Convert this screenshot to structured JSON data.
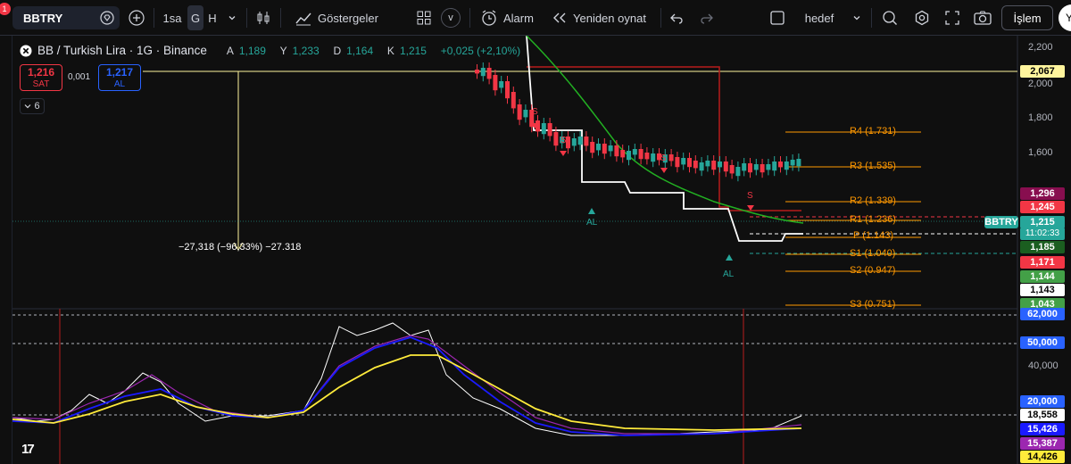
{
  "toolbar": {
    "symbol": "BBTRY",
    "notification_count": "1",
    "intervals": [
      "1sa",
      "G",
      "H"
    ],
    "indicators_label": "Göstergeler",
    "alert_label": "Alarm",
    "replay_label": "Yeniden oynat",
    "v_label": "v",
    "layout_name": "hedef",
    "trade_label": "İşlem",
    "avatar_letter": "Y"
  },
  "legend": {
    "title": "BB / Turkish Lira · 1G · Binance",
    "ohlc": [
      {
        "k": "A",
        "v": "1,189"
      },
      {
        "k": "Y",
        "v": "1,233"
      },
      {
        "k": "D",
        "v": "1,164"
      },
      {
        "k": "K",
        "v": "1,215"
      },
      {
        "k": "",
        "v": "+0,025 (+2,10%)"
      }
    ],
    "sell_price": "1,216",
    "sell_label": "SAT",
    "spread": "0,001",
    "buy_price": "1,217",
    "buy_label": "AL",
    "collapsed_count": "6"
  },
  "measure_text": "−27,318 (−96,33%) −27.318",
  "pivots": [
    "R4 (1.731)",
    "R3 (1.535)",
    "R2 (1.339)",
    "R1 (1.236)",
    "P (1.143)",
    "S1 (1.040)",
    "S2 (0.947)",
    "S3 (0.751)"
  ],
  "signals": {
    "sell": "S",
    "buy": "AL"
  },
  "price_axis": [
    "2,200",
    "2,000",
    "1,800",
    "1,600",
    "40,000"
  ],
  "price_tags": [
    {
      "text": "2,067",
      "bg": "#fff59d",
      "fg": "#000000"
    },
    {
      "text": "1,296",
      "bg": "#880e4f",
      "fg": "#ffffff"
    },
    {
      "text": "1,245",
      "bg": "#f23645",
      "fg": "#ffffff"
    },
    {
      "text": "BBTRY",
      "bg": "#26a69a",
      "fg": "#ffffff"
    },
    {
      "text": "1,215",
      "bg": "#26a69a",
      "fg": "#ffffff"
    },
    {
      "text": "11:02:33",
      "bg": "#26a69a",
      "fg": "#ffffff"
    },
    {
      "text": "1,185",
      "bg": "#1b5e20",
      "fg": "#ffffff"
    },
    {
      "text": "1,171",
      "bg": "#f23645",
      "fg": "#ffffff"
    },
    {
      "text": "1,144",
      "bg": "#43a047",
      "fg": "#ffffff"
    },
    {
      "text": "1,143",
      "bg": "#ffffff",
      "fg": "#000000"
    },
    {
      "text": "1,043",
      "bg": "#43a047",
      "fg": "#ffffff"
    },
    {
      "text": "62,000",
      "bg": "#2962ff",
      "fg": "#ffffff"
    },
    {
      "text": "50,000",
      "bg": "#2962ff",
      "fg": "#ffffff"
    },
    {
      "text": "20,000",
      "bg": "#2962ff",
      "fg": "#ffffff"
    },
    {
      "text": "18,558",
      "bg": "#ffffff",
      "fg": "#000000"
    },
    {
      "text": "15,426",
      "bg": "#1a1aff",
      "fg": "#ffffff"
    },
    {
      "text": "15,387",
      "bg": "#9c27b0",
      "fg": "#ffffff"
    },
    {
      "text": "14,426",
      "bg": "#ffeb3b",
      "fg": "#000000"
    }
  ],
  "logo": "17",
  "colors": {
    "up": "#26a69a",
    "down": "#f23645",
    "pivot": "#ff9800",
    "accent": "#2962ff"
  }
}
